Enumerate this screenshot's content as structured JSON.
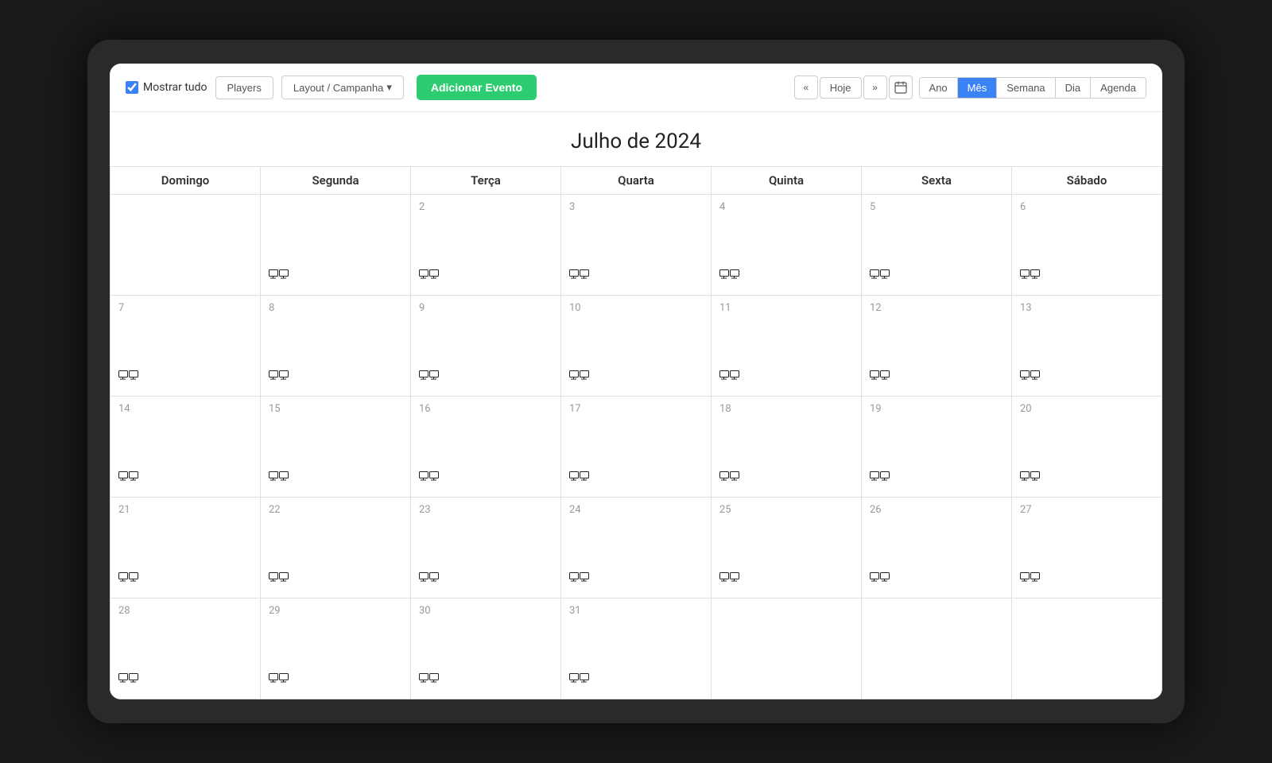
{
  "toolbar": {
    "show_all_label": "Mostrar tudo",
    "players_label": "Players",
    "layout_label": "Layout / Campanha",
    "add_event_label": "Adicionar Evento",
    "today_label": "Hoje",
    "calendar_icon": "📅",
    "view_options": [
      "Ano",
      "Mês",
      "Semana",
      "Dia",
      "Agenda"
    ],
    "active_view": "Mês"
  },
  "calendar": {
    "title": "Julho de 2024",
    "day_headers": [
      "Domingo",
      "Segunda",
      "Terça",
      "Quarta",
      "Quinta",
      "Sexta",
      "Sábado"
    ],
    "weeks": [
      [
        "",
        "",
        "2",
        "3",
        "4",
        "5",
        "6"
      ],
      [
        "7",
        "8",
        "9",
        "10",
        "11",
        "12",
        "13"
      ],
      [
        "14",
        "15",
        "16",
        "17",
        "18",
        "19",
        "20"
      ],
      [
        "21",
        "22",
        "23",
        "24",
        "25",
        "26",
        "27"
      ],
      [
        "28",
        "29",
        "30",
        "31",
        "",
        "",
        ""
      ]
    ],
    "monitor_rows": [
      [
        false,
        true,
        true,
        true,
        true,
        true,
        true
      ],
      [
        true,
        true,
        true,
        true,
        true,
        true,
        true
      ],
      [
        true,
        true,
        true,
        true,
        true,
        true,
        true
      ],
      [
        true,
        true,
        true,
        true,
        true,
        true,
        true
      ],
      [
        true,
        true,
        true,
        true,
        false,
        false,
        false
      ]
    ]
  }
}
